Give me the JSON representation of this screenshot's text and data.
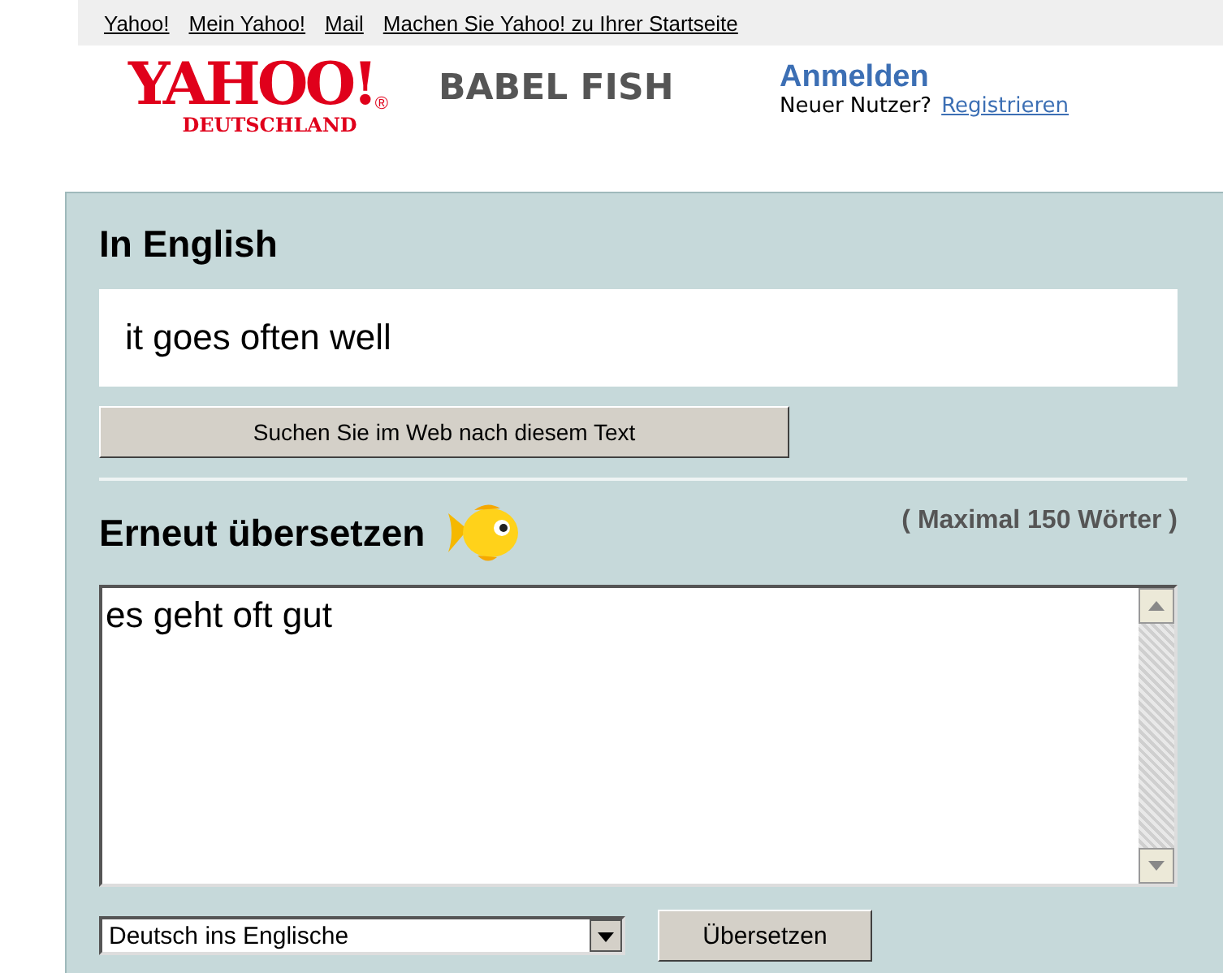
{
  "top_links": [
    "Yahoo!",
    "Mein Yahoo!",
    "Mail",
    "Machen Sie Yahoo! zu Ihrer Startseite"
  ],
  "logo": {
    "wordmark": "YAHOO!",
    "registered": "®",
    "region": "DEUTSCHLAND",
    "product": "BABEL FISH"
  },
  "account": {
    "sign_in": "Anmelden",
    "new_user": "Neuer Nutzer?",
    "register": "Registrieren"
  },
  "result": {
    "heading": "In English",
    "text": "it goes often well",
    "search_button": "Suchen Sie im Web nach diesem Text"
  },
  "retranslate": {
    "heading": "Erneut übersetzen",
    "limit": "( Maximal 150 Wörter )",
    "input": "es geht oft gut",
    "language": "Deutsch ins Englische",
    "translate_button": "Übersetzen"
  }
}
